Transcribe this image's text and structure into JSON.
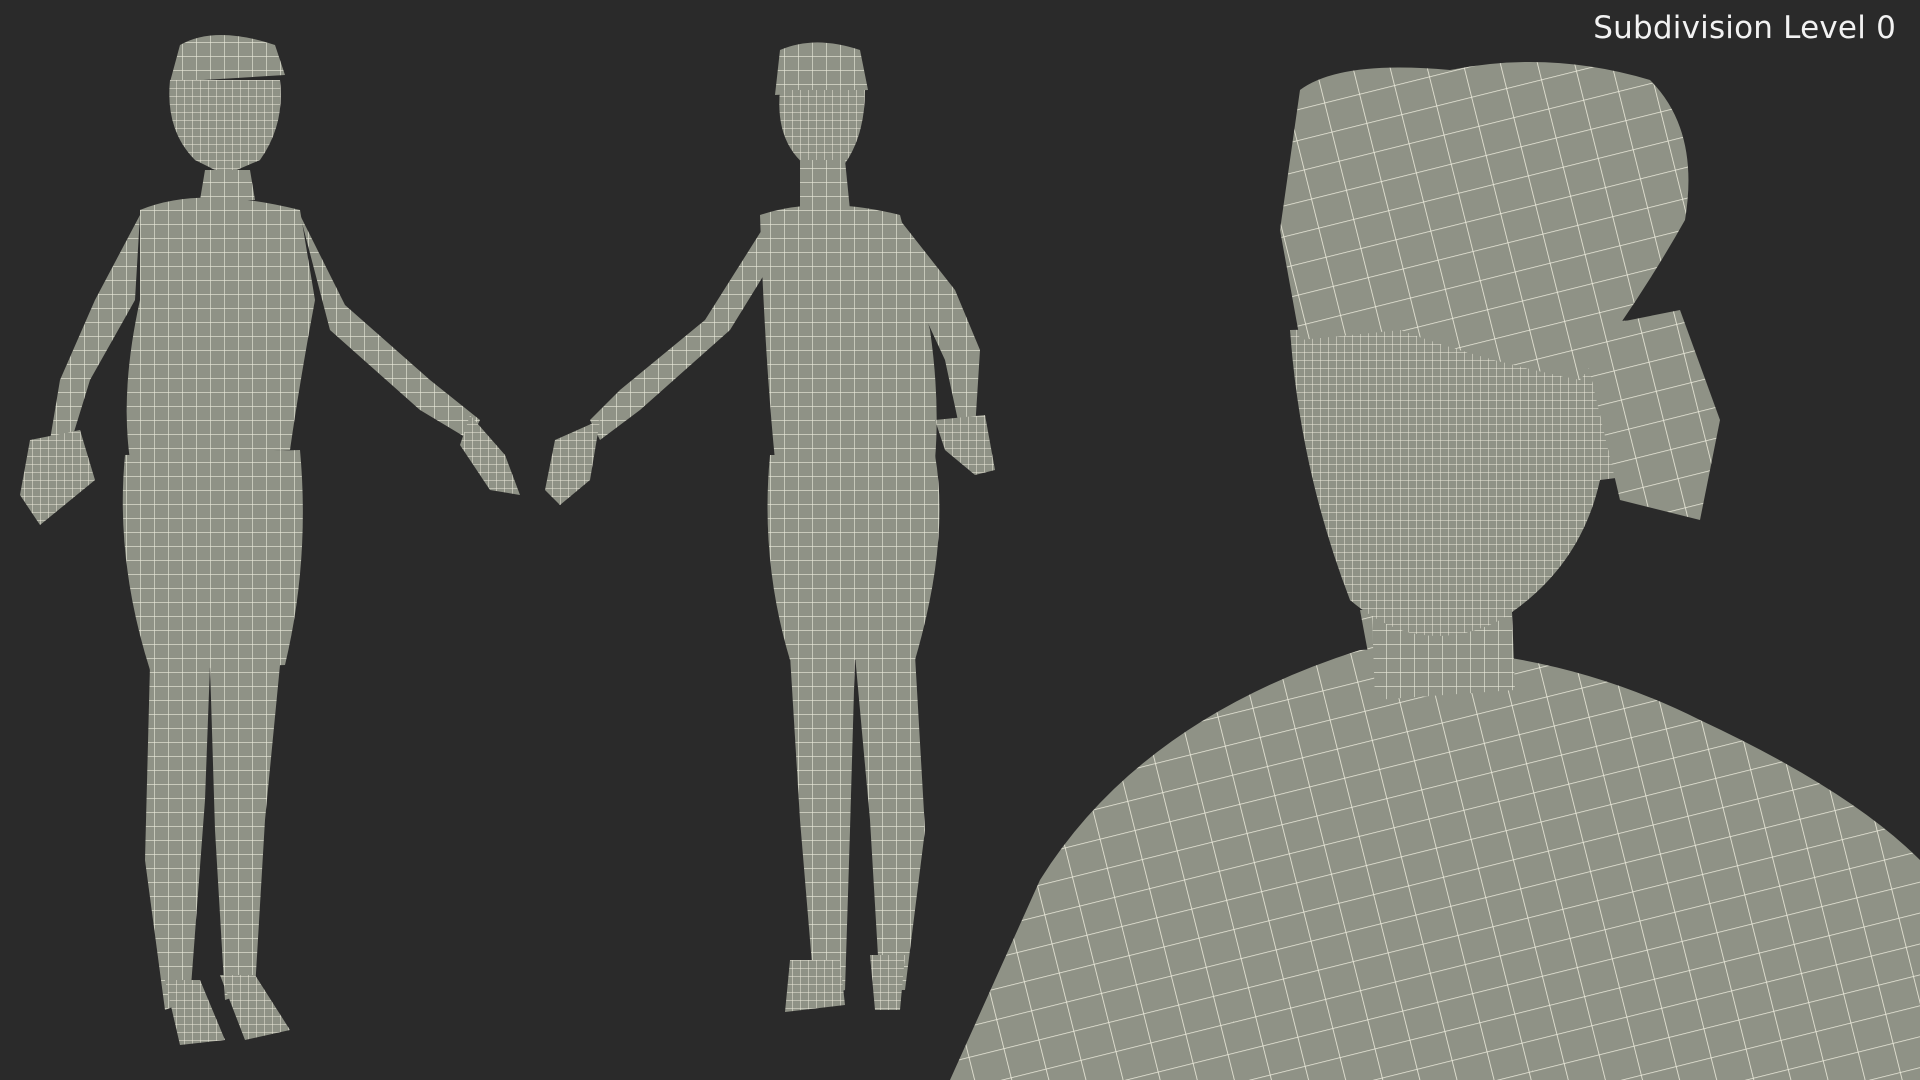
{
  "overlay": {
    "subdivision_label": "Subdivision Level 0"
  },
  "render": {
    "background_color": "#2a2a2a",
    "mesh_fill_color": "#8f9286",
    "wire_color": "#ecebdc"
  }
}
